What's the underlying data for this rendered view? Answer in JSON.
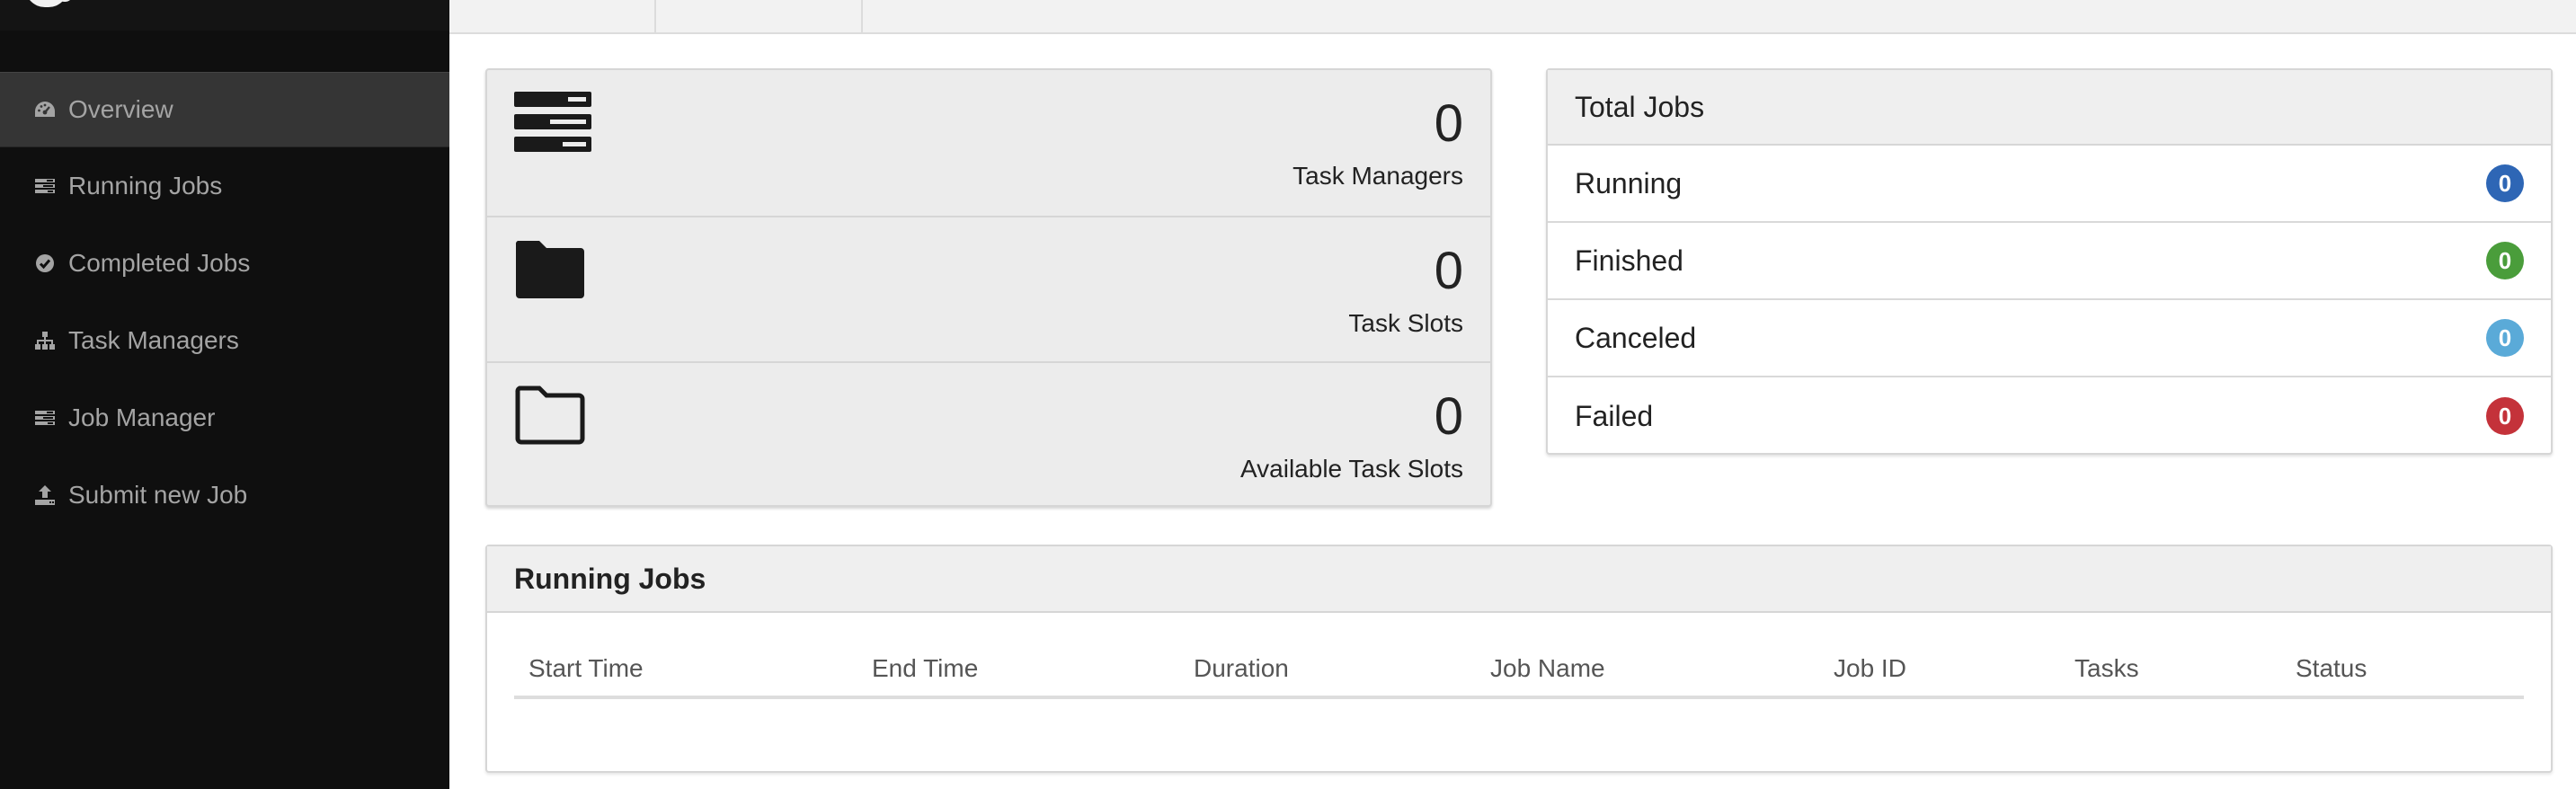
{
  "sidebar": {
    "items": [
      {
        "label": "Overview",
        "icon": "dashboard-icon"
      },
      {
        "label": "Running Jobs",
        "icon": "tasks-icon"
      },
      {
        "label": "Completed Jobs",
        "icon": "check-circle-icon"
      },
      {
        "label": "Task Managers",
        "icon": "sitemap-icon"
      },
      {
        "label": "Job Manager",
        "icon": "tasks-icon"
      },
      {
        "label": "Submit new Job",
        "icon": "upload-icon"
      }
    ],
    "active_index": 0
  },
  "stats": [
    {
      "value": "0",
      "label": "Task Managers",
      "icon": "tasks-icon"
    },
    {
      "value": "0",
      "label": "Task Slots",
      "icon": "folder-icon"
    },
    {
      "value": "0",
      "label": "Available Task Slots",
      "icon": "folder-open-icon"
    }
  ],
  "total_jobs": {
    "title": "Total Jobs",
    "rows": [
      {
        "label": "Running",
        "count": "0",
        "color": "#2e66b5"
      },
      {
        "label": "Finished",
        "count": "0",
        "color": "#4a9d3b"
      },
      {
        "label": "Canceled",
        "count": "0",
        "color": "#5aaad8"
      },
      {
        "label": "Failed",
        "count": "0",
        "color": "#c4323a"
      }
    ]
  },
  "running_jobs": {
    "title": "Running Jobs",
    "columns": [
      "Start Time",
      "End Time",
      "Duration",
      "Job Name",
      "Job ID",
      "Tasks",
      "Status"
    ],
    "rows": []
  },
  "colors": {
    "sidebar_bg": "#0f0f0f",
    "sidebar_active_bg": "#353535",
    "sidebar_text": "#a4a4a4",
    "panel_heading_bg": "#efefef"
  }
}
